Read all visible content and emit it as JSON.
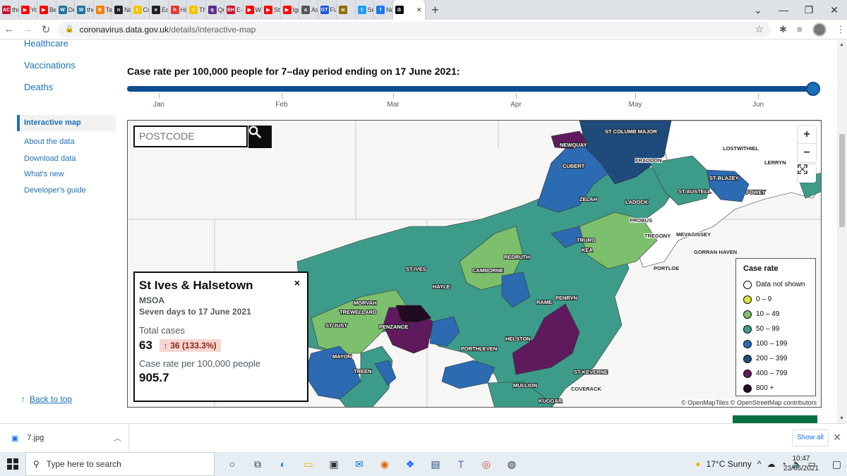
{
  "browser": {
    "tabs": [
      {
        "label": "the",
        "icon": "AC",
        "color": "#c8102e"
      },
      {
        "label": "You",
        "icon": "▶",
        "color": "#ff0000"
      },
      {
        "label": "Bes",
        "icon": "▶",
        "color": "#ff0000"
      },
      {
        "label": "De:",
        "icon": "W",
        "color": "#21759b"
      },
      {
        "label": "the",
        "icon": "W",
        "color": "#21759b"
      },
      {
        "label": "Tai",
        "icon": "B",
        "color": "#f57d00"
      },
      {
        "label": "Nat",
        "icon": "n",
        "color": "#222222"
      },
      {
        "label": "Cor",
        "icon": "c",
        "color": "#f5c400"
      },
      {
        "label": "Eco",
        "icon": "e",
        "color": "#222222"
      },
      {
        "label": "Ho",
        "icon": "h",
        "color": "#e53935"
      },
      {
        "label": "The",
        "icon": "t",
        "color": "#f5c400"
      },
      {
        "label": "Qu",
        "icon": "q",
        "color": "#5c2d91"
      },
      {
        "label": "E-H",
        "icon": "EH",
        "color": "#c8102e"
      },
      {
        "label": "Wh",
        "icon": "▶",
        "color": "#ff0000"
      },
      {
        "label": "Sto",
        "icon": "▶",
        "color": "#ff0000"
      },
      {
        "label": "Igr",
        "icon": "▶",
        "color": "#ff0000"
      },
      {
        "label": "Ass",
        "icon": "a",
        "color": "#555555"
      },
      {
        "label": "Fuc",
        "icon": "GT",
        "color": "#1a56db"
      },
      {
        "label": "",
        "icon": "w",
        "color": "#8d6e00"
      },
      {
        "label": "Sel",
        "icon": "t",
        "color": "#1da1f2"
      },
      {
        "label": "No",
        "icon": "f",
        "color": "#1877f2"
      }
    ],
    "url_host": "coronavirus.data.gov.uk",
    "url_path": "/details/interactive-map"
  },
  "sidebar": {
    "healthcare": "Healthcare",
    "vaccinations": "Vaccinations",
    "deaths": "Deaths",
    "interactive_map": "Interactive map",
    "about": "About the data",
    "download": "Download data",
    "whats_new": "What's new",
    "developer": "Developer's guide",
    "back_to_top": "Back to top"
  },
  "main": {
    "heading": "Case rate per 100,000 people for 7–day period ending on 17 June 2021:",
    "months": [
      "Jan",
      "Feb",
      "Mar",
      "Apr",
      "May",
      "Jun"
    ],
    "slider_fraction": 1.0
  },
  "map": {
    "postcode_placeholder": "POSTCODE",
    "zoom_in": "+",
    "zoom_out": "−",
    "attribution": "© OpenMapTiles © OpenStreetMap contributors",
    "places": [
      "ST COLUMB MAJOR",
      "NEWQUAY",
      "LOSTWITHIEL",
      "CUBERT",
      "FRADDON",
      "LERRYN",
      "ST BLAZEY",
      "ST AUSTELL",
      "FOWEY",
      "ZELAH",
      "LADOCK",
      "PROBUS",
      "TRURO",
      "KEA",
      "TREGONY",
      "MEVAGISSEY",
      "GORRAN HAVEN",
      "PORTLOE",
      "REDRUTH",
      "CAMBORNE",
      "ST IVES",
      "HAYLE",
      "MORVAH",
      "TREWELLARD",
      "ST JUST",
      "PENZANCE",
      "RAME",
      "PENRYN",
      "HELSTON",
      "PORTHLEVEN",
      "MAYON",
      "TREEN",
      "ST KEVERNE",
      "MULLION",
      "COVERACK",
      "KUGGAR"
    ],
    "legend": {
      "title": "Case rate",
      "items": [
        {
          "label": "Data not shown",
          "color": "#ffffff"
        },
        {
          "label": "0 – 9",
          "color": "#e0e33a"
        },
        {
          "label": "10 – 49",
          "color": "#7cbf6c"
        },
        {
          "label": "50 – 99",
          "color": "#3d9b8a"
        },
        {
          "label": "100 – 199",
          "color": "#2c6ab2"
        },
        {
          "label": "200 – 399",
          "color": "#1e4a7c"
        },
        {
          "label": "400 – 799",
          "color": "#5e1a5c"
        },
        {
          "label": "800 +",
          "color": "#220a22"
        }
      ]
    },
    "infobox": {
      "title": "St Ives & Halsetown",
      "type": "MSOA",
      "period": "Seven days to 17 June 2021",
      "total_label": "Total cases",
      "total_value": "63",
      "change": "↑ 36 (133.3%)",
      "rate_label": "Case rate per 100,000 people",
      "rate_value": "905.7",
      "close": "×"
    }
  },
  "downloads": {
    "file": "7.jpg",
    "show_all": "Show all"
  },
  "taskbar": {
    "search_placeholder": "Type here to search",
    "weather": "17°C  Sunny",
    "time": "10:47",
    "date": "23/06/2021"
  }
}
